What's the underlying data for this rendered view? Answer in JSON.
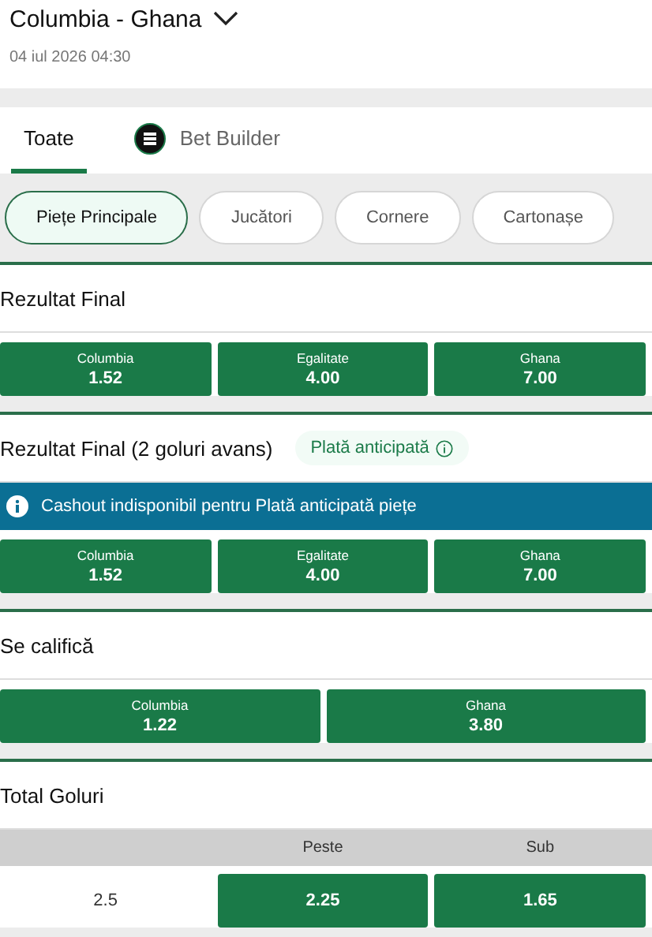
{
  "header": {
    "title": "Columbia - Ghana",
    "date": "04 iul 2026 04:30"
  },
  "tabs": [
    {
      "label": "Toate",
      "selected": true,
      "kind": "text"
    },
    {
      "label": "Bet Builder",
      "selected": false,
      "kind": "icon"
    }
  ],
  "chips": [
    {
      "label": "Piețe Principale",
      "selected": true
    },
    {
      "label": "Jucători",
      "selected": false
    },
    {
      "label": "Cornere",
      "selected": false
    },
    {
      "label": "Cartonașe",
      "selected": false
    }
  ],
  "sections": [
    {
      "kind": "odds",
      "title": "Rezultat Final",
      "outcomes": [
        {
          "label": "Columbia",
          "odds": "1.52"
        },
        {
          "label": "Egalitate",
          "odds": "4.00"
        },
        {
          "label": "Ghana",
          "odds": "7.00"
        }
      ]
    },
    {
      "kind": "odds",
      "title": "Rezultat Final (2 goluri avans)",
      "badge": "Plată anticipată",
      "notice": "Cashout indisponibil pentru Plată anticipată piețe",
      "outcomes": [
        {
          "label": "Columbia",
          "odds": "1.52"
        },
        {
          "label": "Egalitate",
          "odds": "4.00"
        },
        {
          "label": "Ghana",
          "odds": "7.00"
        }
      ]
    },
    {
      "kind": "odds",
      "title": "Se califică",
      "outcomes": [
        {
          "label": "Columbia",
          "odds": "1.22"
        },
        {
          "label": "Ghana",
          "odds": "3.80"
        }
      ]
    },
    {
      "kind": "totals",
      "title": "Total Goluri",
      "columns": [
        "Peste",
        "Sub"
      ],
      "rows": [
        {
          "line": "2.5",
          "odds": [
            "2.25",
            "1.65"
          ]
        }
      ]
    }
  ]
}
